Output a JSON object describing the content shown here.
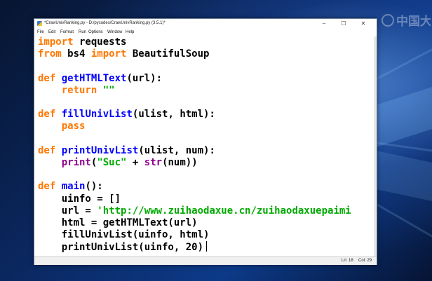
{
  "window": {
    "title": "*CrawUnivRanking.py - D:/pycodes/CrawUnivRanking.py (3.5.1)*",
    "controls": {
      "minimize": "–",
      "maximize": "☐",
      "close": "✕"
    }
  },
  "watermark": {
    "text": "中国大学"
  },
  "menu": {
    "items": [
      "File",
      "Edit",
      "Format",
      "Run",
      "Options",
      "Window",
      "Help"
    ]
  },
  "editor": {
    "lines": [
      [
        {
          "t": "import",
          "c": "kw"
        },
        {
          "t": " requests",
          "c": ""
        }
      ],
      [
        {
          "t": "from",
          "c": "kw"
        },
        {
          "t": " bs4 ",
          "c": ""
        },
        {
          "t": "import",
          "c": "kw"
        },
        {
          "t": " BeautifulSoup",
          "c": ""
        }
      ],
      [],
      [
        {
          "t": "def",
          "c": "kw"
        },
        {
          "t": " ",
          "c": ""
        },
        {
          "t": "getHTMLText",
          "c": "fn"
        },
        {
          "t": "(url):",
          "c": ""
        }
      ],
      [
        {
          "t": "    ",
          "c": ""
        },
        {
          "t": "return",
          "c": "kw"
        },
        {
          "t": " ",
          "c": ""
        },
        {
          "t": "\"\"",
          "c": "str"
        }
      ],
      [],
      [
        {
          "t": "def",
          "c": "kw"
        },
        {
          "t": " ",
          "c": ""
        },
        {
          "t": "fillUnivList",
          "c": "fn"
        },
        {
          "t": "(ulist, html):",
          "c": ""
        }
      ],
      [
        {
          "t": "    ",
          "c": ""
        },
        {
          "t": "pass",
          "c": "kw"
        }
      ],
      [],
      [
        {
          "t": "def",
          "c": "kw"
        },
        {
          "t": " ",
          "c": ""
        },
        {
          "t": "printUnivList",
          "c": "fn"
        },
        {
          "t": "(ulist, num):",
          "c": ""
        }
      ],
      [
        {
          "t": "    ",
          "c": ""
        },
        {
          "t": "print",
          "c": "bi"
        },
        {
          "t": "(",
          "c": ""
        },
        {
          "t": "\"Suc\"",
          "c": "str"
        },
        {
          "t": " + ",
          "c": ""
        },
        {
          "t": "str",
          "c": "bi"
        },
        {
          "t": "(num))",
          "c": ""
        }
      ],
      [],
      [
        {
          "t": "def",
          "c": "kw"
        },
        {
          "t": " ",
          "c": ""
        },
        {
          "t": "main",
          "c": "fn"
        },
        {
          "t": "():",
          "c": ""
        }
      ],
      [
        {
          "t": "    uinfo = []",
          "c": ""
        }
      ],
      [
        {
          "t": "    url = ",
          "c": ""
        },
        {
          "t": "'http://www.zuihaodaxue.cn/zuihaodaxuepaimi",
          "c": "str"
        }
      ],
      [
        {
          "t": "    html = getHTMLText(url)",
          "c": ""
        }
      ],
      [
        {
          "t": "    fillUnivList(uinfo, html)",
          "c": ""
        }
      ],
      [
        {
          "t": "    printUnivList(uinfo, 20)",
          "c": ""
        }
      ]
    ],
    "caret_line": 18
  },
  "status": {
    "line": "Ln: 18",
    "col": "Col: 29"
  },
  "colors": {
    "keyword": "#ff7700",
    "function_name": "#0000ff",
    "string": "#00aa00",
    "builtin": "#900090",
    "desktop_accent": "#0c3a88"
  }
}
